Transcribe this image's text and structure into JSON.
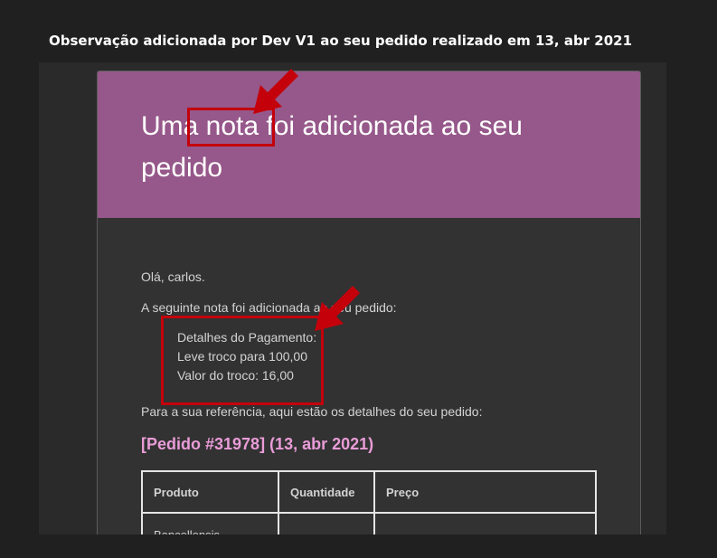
{
  "email_subject": "Observação adicionada por Dev V1 ao seu pedido realizado em 13, abr 2021",
  "header": {
    "title": "Uma nota foi adicionada ao seu pedido",
    "background": "#96588a"
  },
  "body": {
    "greeting": "Olá, carlos.",
    "intro": "A seguinte nota foi adicionada ao seu pedido:",
    "note_lines": [
      "Detalhes do Pagamento:",
      "Leve troco para 100,00",
      "Valor do troco: 16,00"
    ],
    "reference": "Para a sua referência, aqui estão os detalhes do seu pedido:"
  },
  "order": {
    "heading": "[Pedido #31978] (13, abr 2021)",
    "heading_color": "#e99cd7",
    "columns": [
      "Produto",
      "Quantidade",
      "Preço"
    ],
    "rows": [
      [
        "Bancellensis",
        "",
        ""
      ]
    ]
  },
  "annotations": {
    "color": "#c4000b",
    "icons": [
      "arrow-icon",
      "arrow-icon"
    ]
  }
}
